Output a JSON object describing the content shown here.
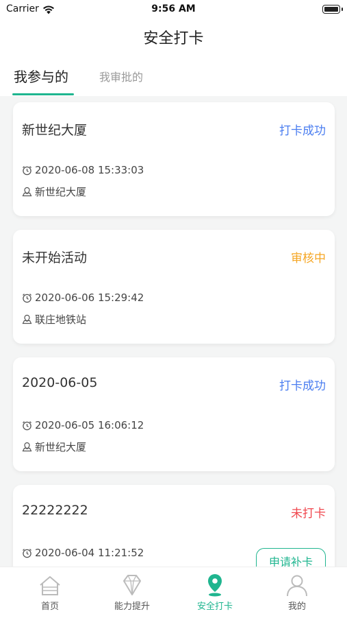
{
  "status_bar": {
    "carrier": "Carrier",
    "time": "9:56 AM"
  },
  "nav": {
    "title": "安全打卡"
  },
  "tabs": [
    {
      "label": "我参与的",
      "active": true
    },
    {
      "label": "我审批的",
      "active": false
    }
  ],
  "records": [
    {
      "title": "新世纪大厦",
      "status": "打卡成功",
      "time": "2020-06-08 15:33:03",
      "location": "新世纪大厦"
    },
    {
      "title": "未开始活动",
      "status": "审核中",
      "time": "2020-06-06 15:29:42",
      "location": "联庄地铁站"
    },
    {
      "title": "2020-06-05",
      "status": "打卡成功",
      "time": "2020-06-05 16:06:12",
      "location": "新世纪大厦"
    },
    {
      "title": "22222222",
      "status": "未打卡",
      "time": "2020-06-04 11:21:52",
      "location": "",
      "action": "申请补卡"
    }
  ],
  "tabbar": [
    {
      "label": "首页",
      "icon": "home-icon"
    },
    {
      "label": "能力提升",
      "icon": "diamond-icon"
    },
    {
      "label": "安全打卡",
      "icon": "location-pin-icon",
      "active": true
    },
    {
      "label": "我的",
      "icon": "user-icon"
    }
  ],
  "colors": {
    "accent": "#1fb58f",
    "success": "#4a7df0",
    "review": "#f5a623",
    "missed": "#f0474e"
  }
}
